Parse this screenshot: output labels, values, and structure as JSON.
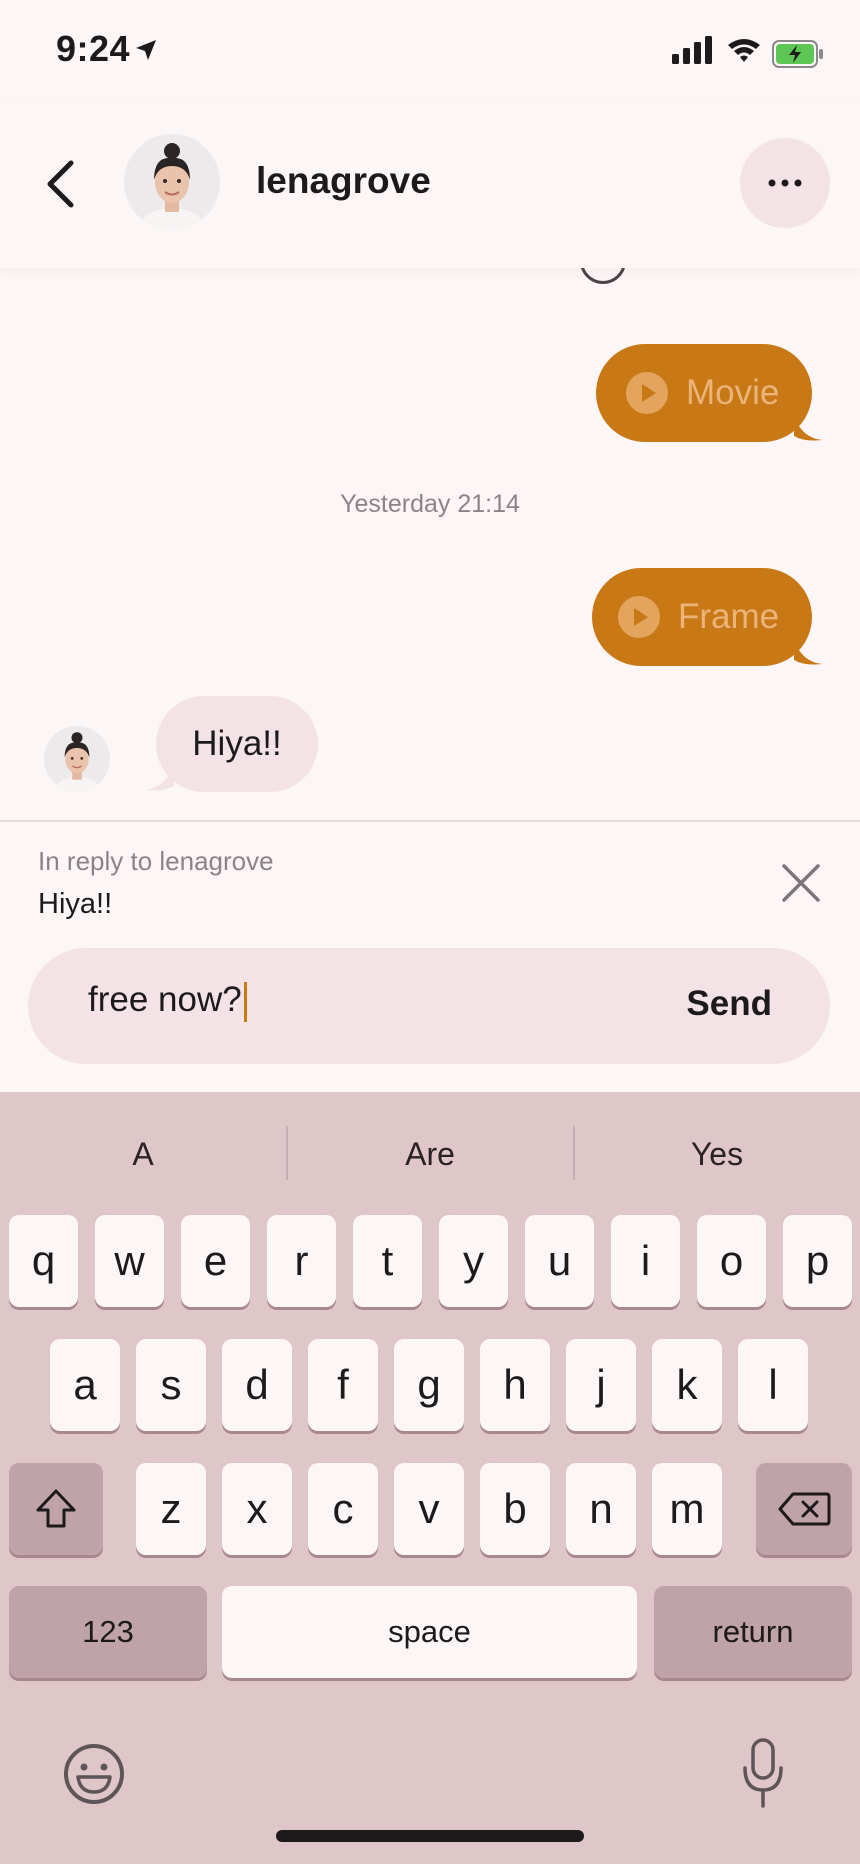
{
  "status_bar": {
    "time": "9:24"
  },
  "header": {
    "name": "lenagrove"
  },
  "messages": {
    "outgoing": [
      {
        "label": "Movie"
      },
      {
        "label": "Frame"
      }
    ],
    "timestamp": "Yesterday 21:14",
    "incoming": {
      "text": "Hiya!!"
    }
  },
  "reply": {
    "caption": "In reply to lenagrove",
    "quote": "Hiya!!"
  },
  "composer": {
    "value": "free now?",
    "send_label": "Send"
  },
  "colors": {
    "accent": "#c97816",
    "bubble_incoming": "#f3e3e6",
    "background": "#fdf6f6",
    "keyboard": "#dfc6c9"
  },
  "keyboard": {
    "suggestions": [
      "A",
      "Are",
      "Yes"
    ],
    "row1": [
      "q",
      "w",
      "e",
      "r",
      "t",
      "y",
      "u",
      "i",
      "o",
      "p"
    ],
    "row2": [
      "a",
      "s",
      "d",
      "f",
      "g",
      "h",
      "j",
      "k",
      "l"
    ],
    "row3": [
      "z",
      "x",
      "c",
      "v",
      "b",
      "n",
      "m"
    ],
    "numbers_label": "123",
    "space_label": "space",
    "return_label": "return"
  }
}
